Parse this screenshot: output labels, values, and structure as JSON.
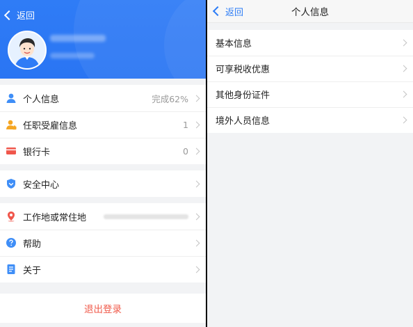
{
  "left": {
    "back_label": "返回",
    "groups": [
      [
        {
          "label": "个人信息",
          "value": "完成62%",
          "icon": "person-icon"
        },
        {
          "label": "任职受雇信息",
          "value": "1",
          "icon": "employee-icon"
        },
        {
          "label": "银行卡",
          "value": "0",
          "icon": "bank-card-icon"
        }
      ],
      [
        {
          "label": "安全中心",
          "value": "",
          "icon": "shield-icon"
        }
      ],
      [
        {
          "label": "工作地或常住地",
          "value": "",
          "icon": "location-pin-icon"
        },
        {
          "label": "帮助",
          "value": "",
          "icon": "help-icon"
        },
        {
          "label": "关于",
          "value": "",
          "icon": "document-icon"
        }
      ]
    ],
    "logout_label": "退出登录"
  },
  "right": {
    "back_label": "返回",
    "title": "个人信息",
    "items": [
      "基本信息",
      "可享税收优惠",
      "其他身份证件",
      "境外人员信息"
    ]
  },
  "colors": {
    "header_blue": "#2f7cf6",
    "link_blue": "#2c7cf6",
    "logout_red": "#f05b4b"
  }
}
